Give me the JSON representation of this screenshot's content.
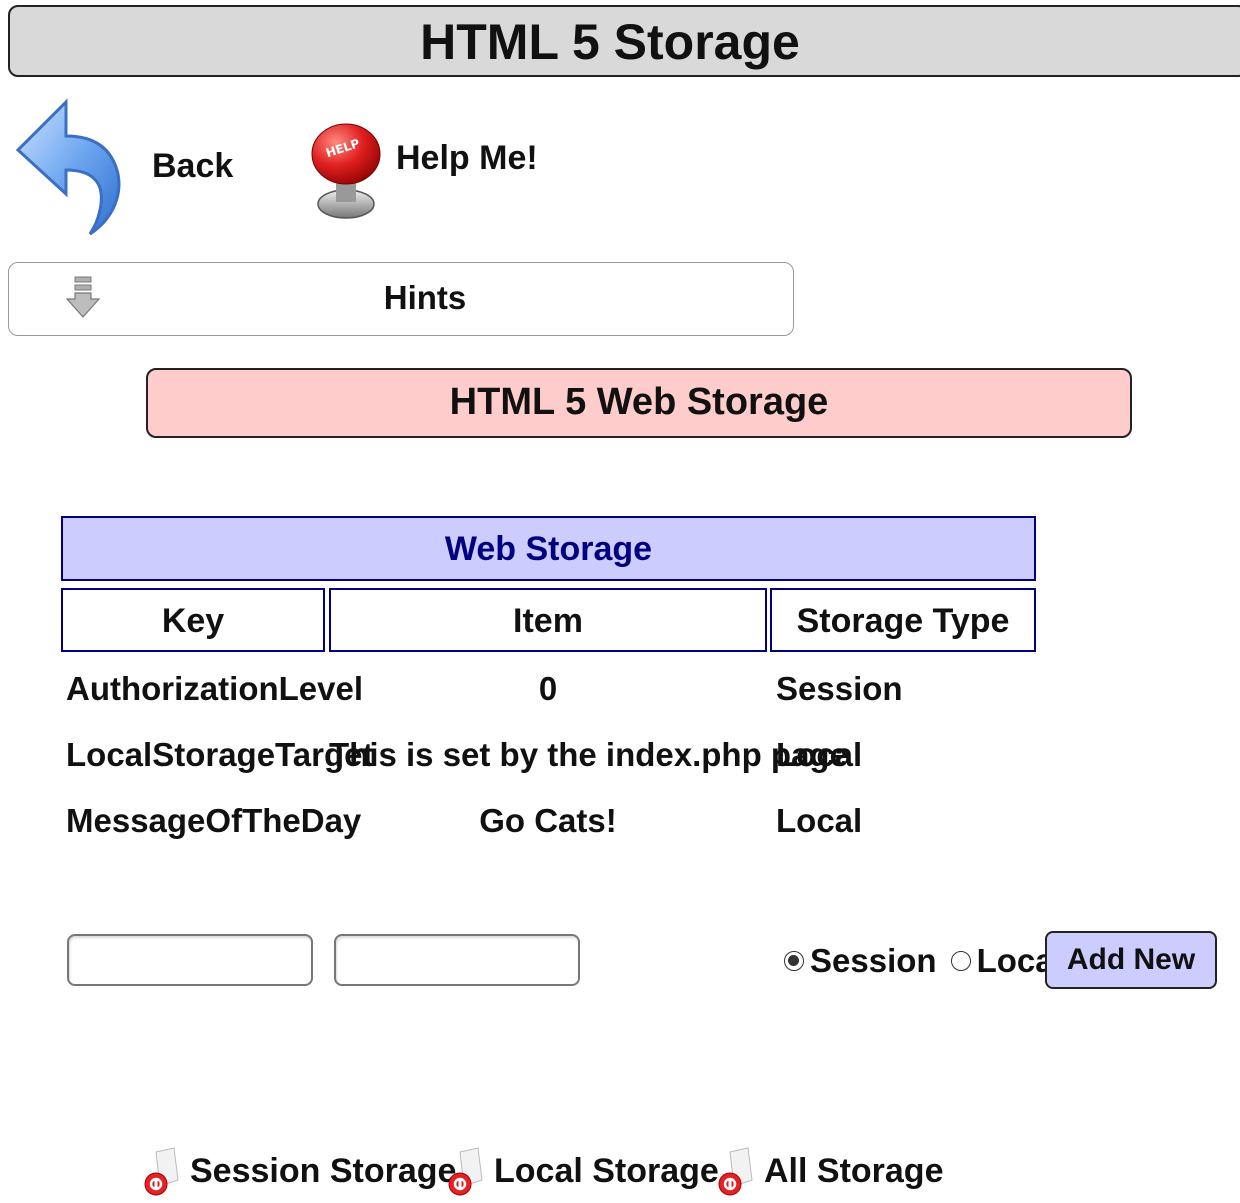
{
  "page": {
    "title": "HTML 5 Storage"
  },
  "nav": {
    "back_label": "Back",
    "back_icon": "back-arrow-icon",
    "help_label": "Help Me!",
    "help_icon": "help-button-icon"
  },
  "hints": {
    "label": "Hints",
    "icon": "arrow-down-icon"
  },
  "section": {
    "title": "HTML 5 Web Storage"
  },
  "table": {
    "title": "Web Storage",
    "columns": [
      "Key",
      "Item",
      "Storage Type"
    ],
    "rows": [
      {
        "key": "AuthorizationLevel",
        "item": "0",
        "type": "Session"
      },
      {
        "key": "LocalStorageTarget",
        "item": "This is set by the index.php page",
        "type": "Local"
      },
      {
        "key": "MessageOfTheDay",
        "item": "Go Cats!",
        "type": "Local"
      }
    ]
  },
  "form": {
    "key_value": "",
    "item_value": "",
    "radio_options": [
      "Session",
      "Local"
    ],
    "selected": "Session",
    "add_button_label": "Add New"
  },
  "bottom_links": [
    {
      "label": "Session Storage",
      "icon": "delete-icon"
    },
    {
      "label": "Local Storage",
      "icon": "delete-icon"
    },
    {
      "label": "All Storage",
      "icon": "delete-icon"
    }
  ],
  "colors": {
    "title_bar_bg": "#d9d9d9",
    "section_header_bg": "#ffcccc",
    "table_header_bg": "#ccccff",
    "table_border": "#000080",
    "button_bg": "#ccccff"
  }
}
